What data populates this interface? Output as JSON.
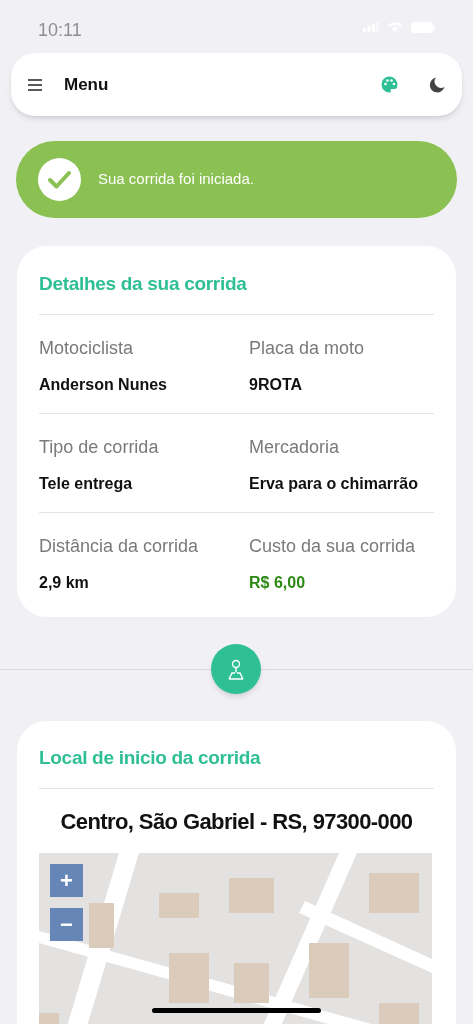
{
  "status_bar": {
    "time": "10:11"
  },
  "header": {
    "title": "Menu"
  },
  "alert": {
    "message": "Sua corrida foi iniciada."
  },
  "details": {
    "title": "Detalhes da sua corrida",
    "rows": [
      [
        {
          "label": "Motociclista",
          "value": "Anderson Nunes",
          "kind": "text"
        },
        {
          "label": "Placa da moto",
          "value": "9ROTA",
          "kind": "text"
        }
      ],
      [
        {
          "label": "Tipo de corrida",
          "value": "Tele entrega",
          "kind": "text"
        },
        {
          "label": "Mercadoria",
          "value": "Erva para o chimarrão",
          "kind": "text"
        }
      ],
      [
        {
          "label": "Distância da corrida",
          "value": "2,9 km",
          "kind": "text"
        },
        {
          "label": "Custo da sua corrida",
          "value": "R$ 6,00",
          "kind": "price"
        }
      ]
    ]
  },
  "start": {
    "title": "Local de inicio da corrida",
    "address": "Centro, São Gabriel - RS, 97300-000",
    "map": {
      "zoom_in": "+",
      "zoom_out": "−"
    }
  }
}
